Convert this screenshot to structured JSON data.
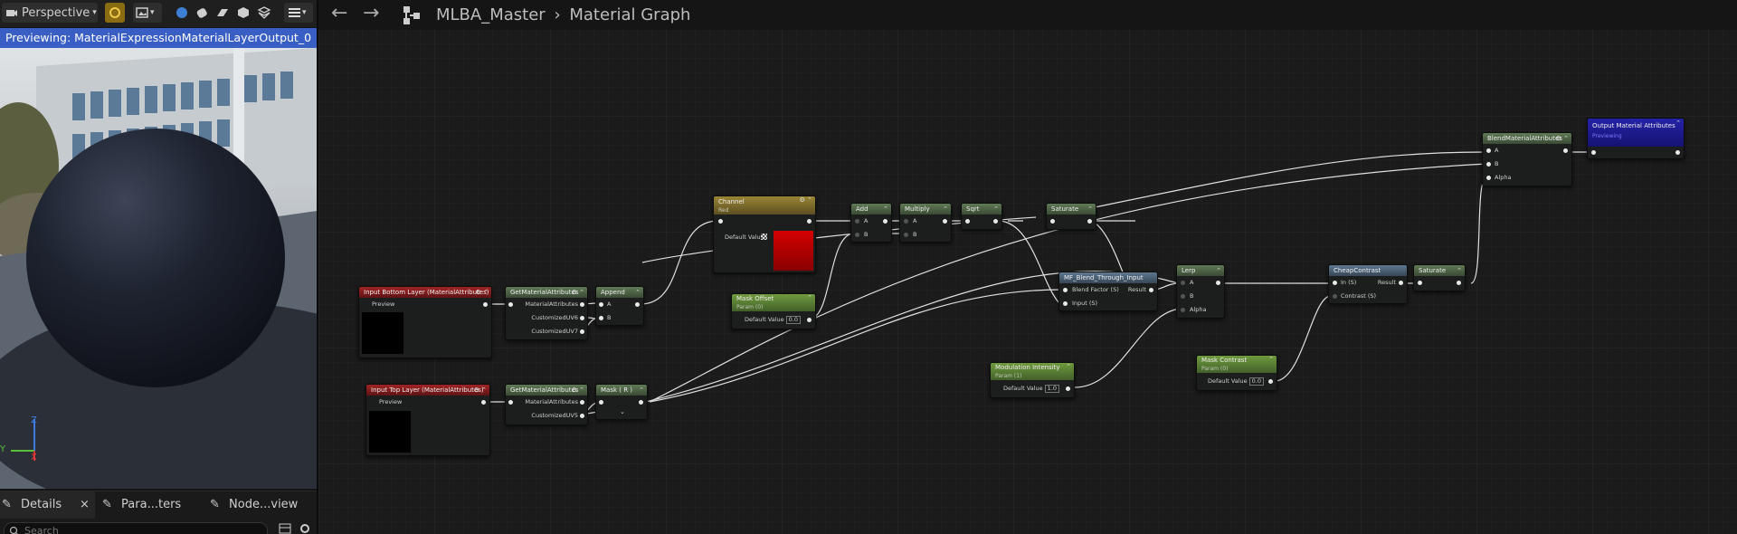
{
  "viewport": {
    "mode_label": "Perspective",
    "preview_label": "Previewing: MaterialExpressionMaterialLayerOutput_0",
    "axis": {
      "z": "Z",
      "y": "Y",
      "x": "X"
    }
  },
  "details_tabs": [
    {
      "label": "Details",
      "icon": "pencil-icon"
    },
    {
      "label": "Para...ters",
      "icon": "pencil-icon"
    },
    {
      "label": "Node...view",
      "icon": "pencil-icon"
    }
  ],
  "search": {
    "placeholder": "Search"
  },
  "breadcrumb": {
    "asset": "MLBA_Master",
    "separator": "›",
    "graph": "Material Graph"
  },
  "colors": {
    "preview_bar": "#3a5fc4",
    "accent": "#d4a017"
  },
  "nodes": {
    "input_bottom": {
      "title": "Input Bottom Layer (MaterialAttributes)",
      "pins": [
        "Preview"
      ]
    },
    "input_top": {
      "title": "Input Top Layer (MaterialAttributes)",
      "pins": [
        "Preview"
      ]
    },
    "get_attr1": {
      "title": "GetMaterialAttributes",
      "pins": [
        "MaterialAttributes",
        "CustomizedUV6",
        "CustomizedUV7"
      ]
    },
    "get_attr2": {
      "title": "GetMaterialAttributes",
      "pins": [
        "MaterialAttributes",
        "CustomizedUV5"
      ]
    },
    "append": {
      "title": "Append",
      "pins": [
        "A",
        "B"
      ]
    },
    "mask": {
      "title": "Mask ( R )"
    },
    "channel": {
      "title": "Channel",
      "subtitle": "Red",
      "default_label": "Default Value"
    },
    "mask_offset": {
      "title": "Mask Offset",
      "subtitle": "Param (0)",
      "default_label": "Default Value",
      "value": "0.0"
    },
    "add": {
      "title": "Add",
      "pins": [
        "A",
        "B"
      ]
    },
    "multiply": {
      "title": "Multiply",
      "pins": [
        "A",
        "B"
      ]
    },
    "sqrt": {
      "title": "Sqrt"
    },
    "saturate1": {
      "title": "Saturate"
    },
    "mf_blend": {
      "title": "MF_Blend_Through_Input",
      "pins": [
        "Blend Factor (S)",
        "Input (S)"
      ],
      "output": "Result"
    },
    "lerp": {
      "title": "Lerp",
      "pins": [
        "A",
        "B",
        "Alpha"
      ]
    },
    "modulation": {
      "title": "Modulation Intensity",
      "subtitle": "Param (1)",
      "default_label": "Default Value",
      "value": "1.0"
    },
    "mask_contrast": {
      "title": "Mask Contrast",
      "subtitle": "Param (0)",
      "default_label": "Default Value",
      "value": "0.0"
    },
    "cheap_contrast": {
      "title": "CheapContrast",
      "pins": [
        "In (S)",
        "Contrast (S)"
      ],
      "output": "Result"
    },
    "saturate2": {
      "title": "Saturate"
    },
    "blend": {
      "title": "BlendMaterialAttributes",
      "pins": [
        "A",
        "B",
        "Alpha"
      ]
    },
    "output": {
      "title": "Output Material Attributes",
      "subtitle": "Previewing"
    }
  }
}
